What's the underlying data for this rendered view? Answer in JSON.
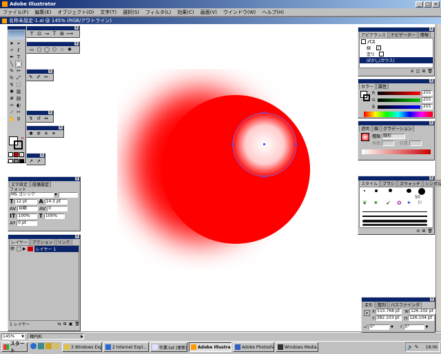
{
  "app": {
    "title": "Adobe Illustrator"
  },
  "menu": [
    "ファイル(F)",
    "編集(E)",
    "オブジェクト(O)",
    "文字(T)",
    "選択(S)",
    "フィルタ(L)",
    "効果(C)",
    "画面(V)",
    "ウインドウ(W)",
    "ヘルプ(H)"
  ],
  "document": {
    "title": "名称未設定-1.ai @ 145% (RGB/アウトライン)"
  },
  "status": {
    "zoom": "145%",
    "tool": "楕円形"
  },
  "appearance": {
    "tabs": [
      "アピアランス",
      "ナビゲーター",
      "情報"
    ],
    "rows": [
      {
        "label": "パス"
      },
      {
        "label": "線"
      },
      {
        "label": "塗り"
      },
      {
        "label": "ぼかし(ガウス)"
      }
    ]
  },
  "color": {
    "tabs": [
      "カラー",
      "属性"
    ],
    "channels": [
      {
        "label": "R",
        "value": "255",
        "color": "#ff0000"
      },
      {
        "label": "G",
        "value": "255",
        "color": "#00c000"
      },
      {
        "label": "B",
        "value": "255",
        "color": "#0000ff"
      }
    ]
  },
  "gradient": {
    "tabs": [
      "透明",
      "線",
      "グラデーション"
    ],
    "type_label": "種類",
    "type_value": "線形",
    "angle_label": "角度",
    "position_label": "位置"
  },
  "brushes": {
    "tabs": [
      "スタイル",
      "ブラシ",
      "スウォッチ",
      "シンボル"
    ],
    "size": "50"
  },
  "character": {
    "tabs": [
      "文字設定",
      "段落設定"
    ],
    "font_label": "フォント",
    "font_value": "MS ゴシック",
    "size": "12 pt",
    "leading": "14.5 pt",
    "kerning": "自動",
    "tracking": "0",
    "vscale": "100%",
    "hscale": "100%",
    "baseline": "0 pt"
  },
  "layers": {
    "tabs": [
      "レイヤー",
      "アクション",
      "リンク"
    ],
    "items": [
      {
        "name": "レイヤー 1"
      }
    ],
    "footer": "1 レイヤー"
  },
  "transform": {
    "tabs": [
      "変形",
      "整列",
      "パスファインダ"
    ],
    "x_label": "X",
    "x": "515.768 pt",
    "y_label": "Y",
    "y": "382.103 pt",
    "w_label": "W",
    "w": "126.102 pt",
    "h_label": "H",
    "h": "126.104 pt",
    "rotate": "0°",
    "shear": "0°"
  },
  "colors": {
    "accent": "#0a246a",
    "desktop": "#c0c0c0",
    "red": "#ff0000"
  },
  "taskbar": {
    "start": "スタート",
    "tasks": [
      {
        "label": "3 Windows Exp...",
        "icon": "folder-icon"
      },
      {
        "label": "2 Internet Expl...",
        "icon": "ie-icon"
      },
      {
        "label": "作業.txt (更新)...",
        "icon": "notepad-icon"
      },
      {
        "label": "Adobe Illustrat...",
        "icon": "illustrator-icon",
        "active": true
      },
      {
        "label": "Adobe Photoshop",
        "icon": "photoshop-icon"
      },
      {
        "label": "Windows Media...",
        "icon": "media-icon"
      }
    ],
    "clock": "18:06"
  }
}
